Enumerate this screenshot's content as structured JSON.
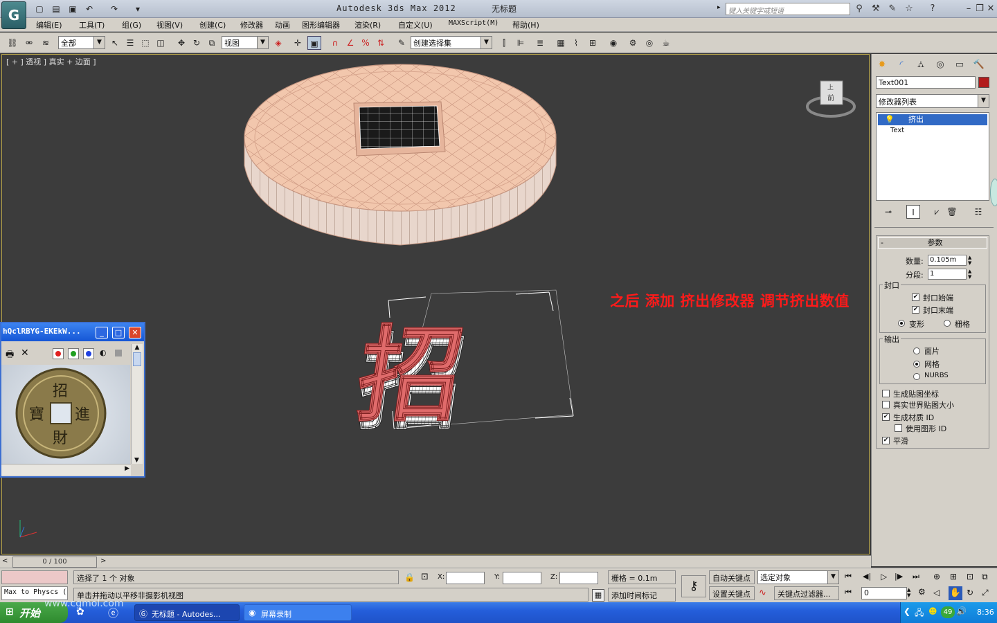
{
  "app": {
    "title": "Autodesk 3ds Max  2012",
    "document": "无标题",
    "search_placeholder": "键入关键字或短语"
  },
  "menu": [
    "编辑(E)",
    "工具(T)",
    "组(G)",
    "视图(V)",
    "创建(C)",
    "修改器",
    "动画",
    "图形编辑器",
    "渲染(R)",
    "自定义(U)",
    "MAXScript(M)",
    "帮助(H)"
  ],
  "toolbar": {
    "selection_filter": "全部",
    "ref_coord": "视图",
    "named_selection": "创建选择集"
  },
  "viewport": {
    "label": "[ + ] 透视 ] 真实 + 边面 ]",
    "annotation": "之后 添加 挤出修改器 调节挤出数值",
    "text_object": "招",
    "viewcube_top": "上",
    "viewcube_front": "前"
  },
  "command_panel": {
    "object_name": "Text001",
    "object_color": "#b21c1c",
    "modifier_list": "修改器列表",
    "stack": [
      "挤出",
      "Text"
    ],
    "parameters": {
      "title": "参数",
      "amount_label": "数量:",
      "amount": "0.105m",
      "segments_label": "分段:",
      "segments": "1",
      "capping_title": "封口",
      "cap_start": "封口始端",
      "cap_start_checked": true,
      "cap_end": "封口末端",
      "cap_end_checked": true,
      "morph": "变形",
      "grid": "栅格",
      "capping_mode": "变形",
      "output_title": "输出",
      "output_options": [
        "面片",
        "网格",
        "NURBS"
      ],
      "output_selected": "网格",
      "gen_map_coords": "生成贴图坐标",
      "gen_map_coords_checked": false,
      "real_world": "真实世界贴图大小",
      "real_world_checked": false,
      "gen_mat_ids": "生成材质 ID",
      "gen_mat_ids_checked": true,
      "use_shape_ids": "使用图形 ID",
      "use_shape_ids_checked": false,
      "smooth": "平滑",
      "smooth_checked": true
    }
  },
  "float_window": {
    "title": "hQclRBYG-EKEkW...",
    "coin_chars": [
      "招",
      "進",
      "財",
      "寶"
    ]
  },
  "timeline": {
    "frame": "0 / 100"
  },
  "status": {
    "selection": "选择了 1 个 对象",
    "prompt": "单击并拖动以平移非摄影机视图",
    "script": "Max to Physcs (",
    "x_label": "X:",
    "y_label": "Y:",
    "z_label": "Z:",
    "grid": "栅格 = 0.1m",
    "add_time_tag": "添加时间标记",
    "auto_key": "自动关键点",
    "set_key": "设置关键点",
    "selected_object": "选定对象",
    "key_filters": "关键点过滤器...",
    "current_frame": "0"
  },
  "taskbar": {
    "start": "开始",
    "tasks": [
      "无标题 - Autodes...",
      "屏幕录制"
    ],
    "clock": "8:36",
    "tray_badge": "49",
    "watermark": "www.cgmol.com"
  }
}
